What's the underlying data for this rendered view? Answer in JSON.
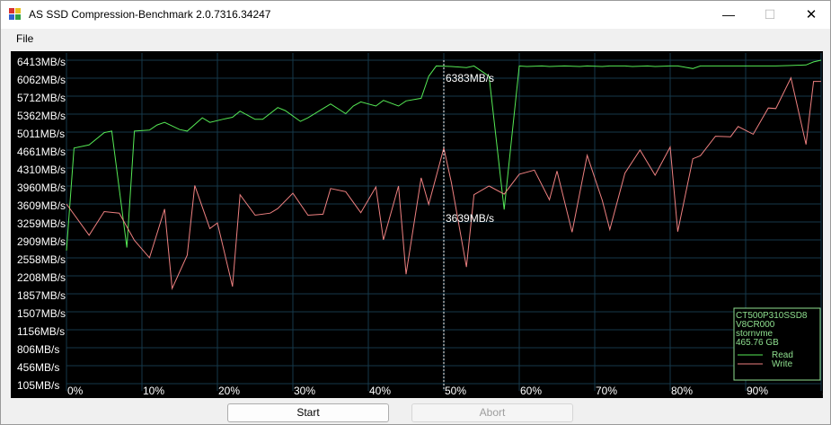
{
  "window": {
    "title": "AS SSD Compression-Benchmark 2.0.7316.34247"
  },
  "titlebar": {
    "minimize": "—",
    "maximize": "☐",
    "close": "✕"
  },
  "menu": {
    "file": "File"
  },
  "chart_data": {
    "type": "line",
    "y_ticks": [
      "6413MB/s",
      "6062MB/s",
      "5712MB/s",
      "5362MB/s",
      "5011MB/s",
      "4661MB/s",
      "4310MB/s",
      "3960MB/s",
      "3609MB/s",
      "3259MB/s",
      "2909MB/s",
      "2558MB/s",
      "2208MB/s",
      "1857MB/s",
      "1507MB/s",
      "1156MB/s",
      "806MB/s",
      "456MB/s",
      "105MB/s"
    ],
    "x_ticks": [
      "0%",
      "10%",
      "20%",
      "30%",
      "40%",
      "50%",
      "60%",
      "70%",
      "80%",
      "90%",
      "100%"
    ],
    "ylim": [
      105,
      6413
    ],
    "xlim": [
      0,
      100
    ],
    "grid": true,
    "marker": {
      "x": 50,
      "read_label": "6383MB/s",
      "write_label": "3639MB/s"
    },
    "legend": {
      "position": "bottom-right",
      "lines": [
        "CT500P310SSD8",
        "V8CR000",
        "stornvme",
        "465.76 GB"
      ],
      "read": "Read",
      "write": "Write"
    },
    "series": [
      {
        "name": "Read",
        "color": "#55e855",
        "x": [
          0,
          1,
          3,
          5,
          6,
          8,
          9,
          11,
          12,
          13,
          15,
          16,
          18,
          19,
          21,
          22,
          23,
          25,
          26,
          28,
          29,
          31,
          32,
          34,
          35,
          37,
          38,
          39,
          41,
          42,
          44,
          45,
          47,
          48,
          49,
          51,
          53,
          54,
          56,
          58,
          60,
          61,
          63,
          64,
          66,
          68,
          69,
          71,
          72,
          74,
          75,
          77,
          78,
          80,
          81,
          83,
          84,
          86,
          88,
          90,
          91,
          93,
          94,
          96,
          98,
          99,
          100
        ],
        "y": [
          2700,
          4700,
          4760,
          5000,
          5030,
          2760,
          5030,
          5050,
          5150,
          5200,
          5060,
          5030,
          5290,
          5200,
          5270,
          5300,
          5420,
          5260,
          5260,
          5490,
          5430,
          5220,
          5290,
          5470,
          5560,
          5370,
          5520,
          5600,
          5520,
          5630,
          5520,
          5620,
          5670,
          6100,
          6300,
          6290,
          6270,
          6300,
          6100,
          3500,
          6300,
          6290,
          6300,
          6290,
          6300,
          6290,
          6300,
          6290,
          6300,
          6300,
          6290,
          6300,
          6290,
          6300,
          6300,
          6250,
          6300,
          6300,
          6300,
          6300,
          6300,
          6300,
          6300,
          6310,
          6320,
          6380,
          6413
        ]
      },
      {
        "name": "Write",
        "color": "#ee8080",
        "x": [
          0,
          3,
          5,
          7,
          9,
          11,
          13,
          14,
          16,
          17,
          19,
          20,
          22,
          23,
          25,
          27,
          28,
          30,
          32,
          34,
          35,
          37,
          39,
          41,
          42,
          44,
          45,
          47,
          48,
          50,
          51,
          53,
          54,
          56,
          58,
          60,
          62,
          64,
          65,
          67,
          69,
          71,
          72,
          74,
          76,
          78,
          80,
          81,
          83,
          84,
          86,
          88,
          89,
          91,
          93,
          94,
          96,
          98,
          99,
          100
        ],
        "y": [
          3609,
          3000,
          3460,
          3430,
          2900,
          2560,
          3510,
          1960,
          2610,
          3970,
          3130,
          3240,
          2000,
          3790,
          3390,
          3430,
          3520,
          3820,
          3390,
          3410,
          3910,
          3850,
          3440,
          3940,
          2910,
          3960,
          2240,
          4120,
          3600,
          4700,
          4030,
          2380,
          3790,
          3960,
          3800,
          4190,
          4270,
          3690,
          4250,
          3060,
          4560,
          3680,
          3110,
          4210,
          4660,
          4170,
          4720,
          3070,
          4490,
          4550,
          4930,
          4920,
          5120,
          4970,
          5480,
          5470,
          6070,
          4770,
          6000,
          6000
        ]
      }
    ]
  }
}
